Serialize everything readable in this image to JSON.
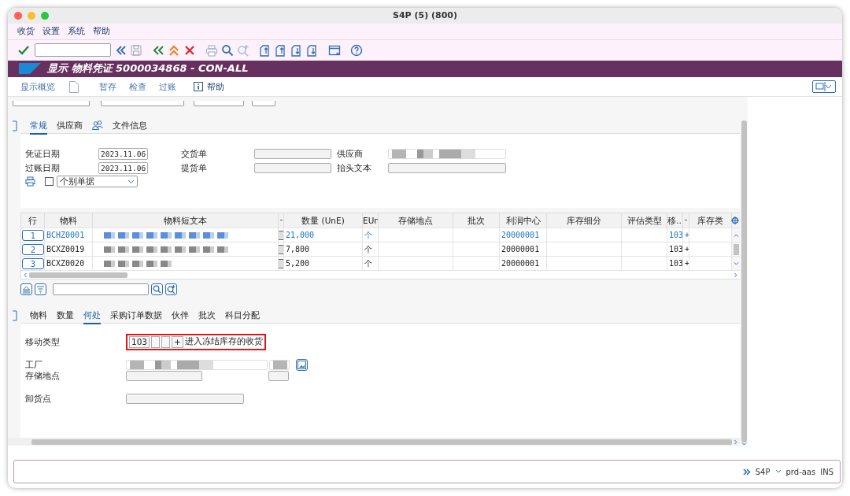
{
  "window": {
    "title": "S4P (5) (800)"
  },
  "menu": [
    "收货",
    "设置",
    "系统",
    "帮助"
  ],
  "title_bar": {
    "title": "显示 物料凭证 5000034868 - CON-ALL"
  },
  "app_toolbar": [
    {
      "kind": "text",
      "label": "显示概览"
    },
    {
      "kind": "icon"
    },
    {
      "kind": "text",
      "label": "暂存"
    },
    {
      "kind": "text",
      "label": "检查"
    },
    {
      "kind": "text",
      "label": "过账"
    },
    {
      "kind": "help",
      "label": "帮助"
    }
  ],
  "header_tabs": [
    {
      "kind": "text",
      "label": "常规",
      "selected": true
    },
    {
      "kind": "text",
      "label": "供应商",
      "selected": false
    },
    {
      "kind": "icon",
      "selected": false
    },
    {
      "kind": "text",
      "label": "文件信息",
      "selected": false
    }
  ],
  "header_fields": [
    {
      "label": "凭证日期",
      "kind": "date",
      "value": "2023.11.06"
    },
    {
      "label": "交货单",
      "kind": "empty"
    },
    {
      "label": "供应商",
      "kind": "blurred"
    },
    {
      "label": "过账日期",
      "kind": "date",
      "value": "2023.11.06"
    },
    {
      "label": "提货单",
      "kind": "empty"
    },
    {
      "label": "抬头文本",
      "kind": "empty"
    }
  ],
  "print_options": {
    "checked": false,
    "dropdown": "个别单据"
  },
  "table": {
    "columns": [
      {
        "label": "行"
      },
      {
        "label": "物料"
      },
      {
        "label": "物料短文本"
      },
      {
        "kind": "narrow"
      },
      {
        "label": "数量 (UnE)"
      },
      {
        "label": "EUn"
      },
      {
        "label": "存储地点"
      },
      {
        "label": "批次"
      },
      {
        "label": "利润中心"
      },
      {
        "label": "库存细分"
      },
      {
        "label": "评估类型"
      },
      {
        "label": "移…"
      },
      {
        "kind": "narrow"
      },
      {
        "label": "库存类"
      }
    ],
    "rows": [
      {
        "row": "1",
        "material": "BCHZ0001",
        "quantity": "21,000",
        "unit": "个",
        "profit_center": "20000001",
        "movement_type": "103",
        "sign": "+",
        "selected": true
      },
      {
        "row": "2",
        "material": "BCXZ0019",
        "quantity": "7,800",
        "unit": "个",
        "profit_center": "20000001",
        "movement_type": "103",
        "sign": "+",
        "selected": false
      },
      {
        "row": "3",
        "material": "BCXZ0020",
        "quantity": "5,200",
        "unit": "个",
        "profit_center": "20000001",
        "movement_type": "103",
        "sign": "+",
        "selected": false
      }
    ]
  },
  "item_tabs": [
    {
      "label": "物料",
      "selected": false
    },
    {
      "label": "数量",
      "selected": false
    },
    {
      "label": "何处",
      "selected": true
    },
    {
      "label": "采购订单数据",
      "selected": false
    },
    {
      "label": "伙伴",
      "selected": false
    },
    {
      "label": "批次",
      "selected": false
    },
    {
      "label": "科目分配",
      "selected": false
    }
  ],
  "movement_type": {
    "label": "移动类型",
    "code": "103",
    "sign": "+",
    "text": "进入冻结库存的收货",
    "highlighted": true
  },
  "detail_fields": [
    {
      "label": "工厂",
      "kind": "blurred"
    },
    {
      "label": "存储地点",
      "kind": "empty"
    },
    {
      "label": "卸货点",
      "kind": "wide"
    }
  ],
  "status_bar": {
    "system": "S4P",
    "server": "prd-aas",
    "mode": "INS"
  }
}
